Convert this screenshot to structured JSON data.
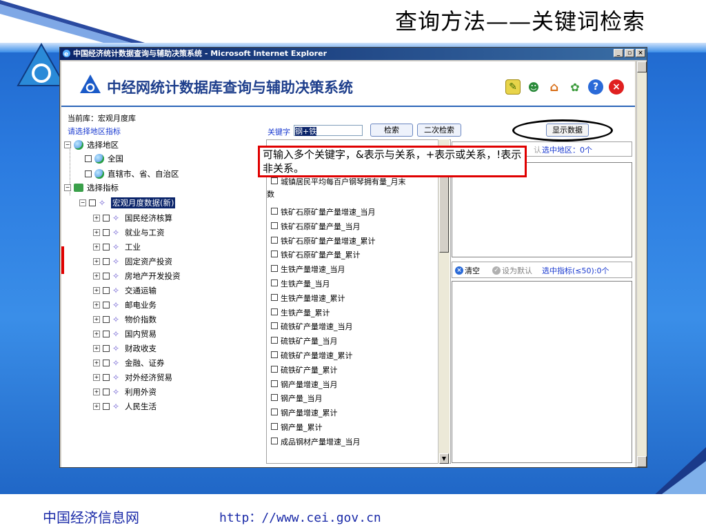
{
  "slide": {
    "title": "查询方法——关键词检索",
    "footer_org": "中国经济信息网",
    "footer_url": "http：//www.cei.gov.cn"
  },
  "window": {
    "title": "中国经济统计数据查询与辅助决策系统 - Microsoft Internet Explorer",
    "controls": [
      "_",
      "▫",
      "×"
    ]
  },
  "app": {
    "title": "中经网统计数据库查询与辅助决策系统",
    "toolbar_icons": [
      "key-icon",
      "users-icon",
      "home-icon",
      "tools-icon",
      "help-icon",
      "close-icon"
    ]
  },
  "query": {
    "current_db": "当前库：宏观月度库",
    "pick_region": "请选择地区指标",
    "keyword_label": "关键字",
    "keyword_value": "钢+铁",
    "search_button": "检索",
    "second_search_button": "二次检索",
    "show_data_button": "显示数据"
  },
  "tree": {
    "region_root": "选择地区",
    "region_items": [
      "全国",
      "直辖市、省、自治区"
    ],
    "indicator_root": "选择指标",
    "selected_db": "宏观月度数据(新)",
    "categories": [
      "国民经济核算",
      "就业与工资",
      "工业",
      "固定资产投资",
      "房地产开发投资",
      "交通运输",
      "邮电业务",
      "物价指数",
      "国内贸易",
      "财政收支",
      "金融、证券",
      "对外经济贸易",
      "利用外资",
      "人民生活"
    ]
  },
  "results": {
    "partial_top": "城镇居民平均每百户钢琴拥有量_月末",
    "partial_top_tail": "数",
    "items": [
      "铁矿石原矿量产量增速_当月",
      "铁矿石原矿量产量_当月",
      "铁矿石原矿量产量增速_累计",
      "铁矿石原矿量产量_累计",
      "生铁产量增速_当月",
      "生铁产量_当月",
      "生铁产量增速_累计",
      "生铁产量_累计",
      "硫铁矿产量增速_当月",
      "硫铁矿产量_当月",
      "硫铁矿产量增速_累计",
      "硫铁矿产量_累计",
      "钢产量增速_当月",
      "钢产量_当月",
      "钢产量增速_累计",
      "钢产量_累计",
      "成品钢材产量增速_当月"
    ]
  },
  "callout": {
    "text": "可输入多个关键字，&表示与关系，+表示或关系，!表示非关系。"
  },
  "right_panel": {
    "faded_label": "认",
    "selected_region": "选中地区：0个",
    "clear": "清空",
    "set_default": "设为默认",
    "selected_indicators": "选中指标(≤50):0个"
  }
}
